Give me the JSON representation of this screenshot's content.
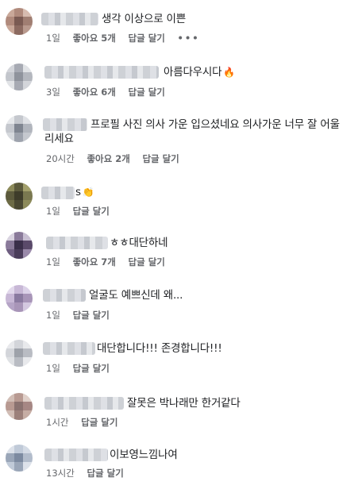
{
  "comments": [
    {
      "text": "생각 이상으로 이쁜",
      "time": "1일",
      "like_label": "좋아요 5개",
      "reply_label": "답글 달기",
      "more_label": "•••"
    },
    {
      "text": "아름다우시다",
      "emoji": "🔥",
      "time": "3일",
      "like_label": "좋아요 6개",
      "reply_label": "답글 달기"
    },
    {
      "text": "프로필 사진 의사 가운 입으셨네요 의사가운 너무 잘 어울",
      "text2": "리세요",
      "time": "20시간",
      "like_label": "좋아요 2개",
      "reply_label": "답글 달기"
    },
    {
      "text": "s",
      "emoji": "👏",
      "time": "1일",
      "reply_label": "답글 달기"
    },
    {
      "text": "ㅎㅎ대단하네",
      "time": "1일",
      "like_label": "좋아요 7개",
      "reply_label": "답글 달기"
    },
    {
      "text": "얼굴도 예쁘신데 왜...",
      "time": "1일",
      "reply_label": "답글 달기"
    },
    {
      "text": "대단합니다!!! 존경합니다!!!",
      "time": "1일",
      "reply_label": "답글 달기"
    },
    {
      "text": "잘못은 박나래만 한거같다",
      "time": "1시간",
      "reply_label": "답글 달기"
    },
    {
      "text": "이보영느낌나여",
      "time": "13시간",
      "reply_label": "답글 달기"
    }
  ],
  "avatar_colors": [
    [
      "#7a5a52",
      "#b08a7c",
      "#c9a899"
    ],
    [
      "#a7aab3",
      "#c3c6cc",
      "#8f939c"
    ],
    [
      "#9ea3ad",
      "#c5c8ce",
      "#7f8590"
    ],
    [
      "#5c5a3c",
      "#8c8a5a",
      "#3e3c2a"
    ],
    [
      "#5a4a6a",
      "#8a7a9a",
      "#3a2f4a"
    ],
    [
      "#a895b8",
      "#c8b8d6",
      "#8a7aa0"
    ],
    [
      "#b9bcc3",
      "#d3d5da",
      "#9ea2aa"
    ],
    [
      "#8a7270",
      "#b89a92",
      "#d1bdb5"
    ],
    [
      "#9aa6b8",
      "#c0cad8",
      "#7c8aa0"
    ]
  ]
}
